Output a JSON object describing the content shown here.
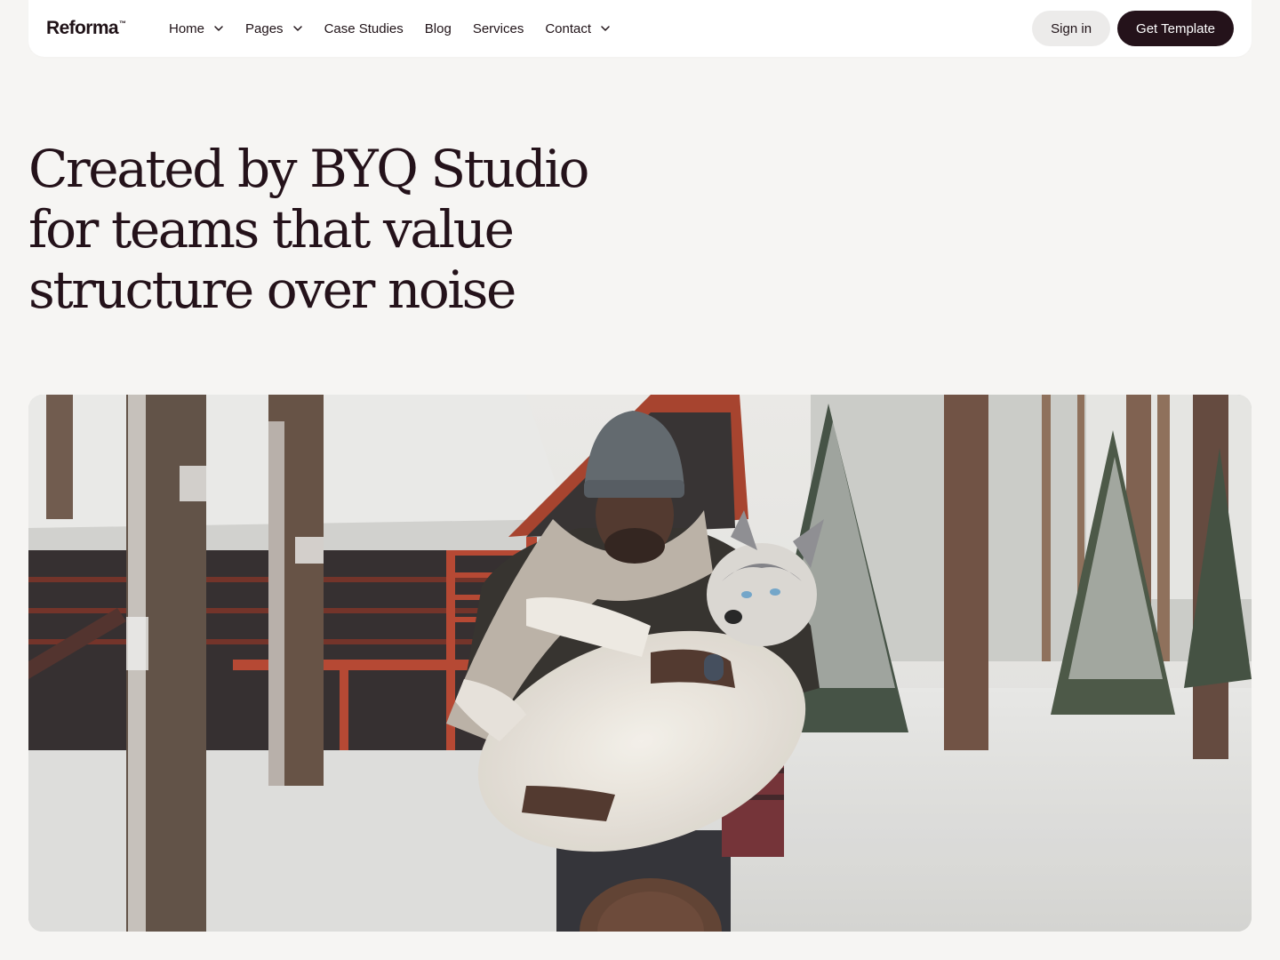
{
  "brand": {
    "name": "Reforma",
    "trademark": "™"
  },
  "nav": {
    "items": [
      {
        "label": "Home",
        "dropdown": true
      },
      {
        "label": "Pages",
        "dropdown": true
      },
      {
        "label": "Case Studies",
        "dropdown": false
      },
      {
        "label": "Blog",
        "dropdown": false
      },
      {
        "label": "Services",
        "dropdown": false
      },
      {
        "label": "Contact",
        "dropdown": true
      }
    ],
    "sign_in_label": "Sign in",
    "cta_label": "Get Template"
  },
  "hero": {
    "title_lines": [
      "Created by BYQ Studio",
      "for teams that value",
      "structure over noise"
    ],
    "image_subject": "man in a beanie carrying a husky dog in a snowy forest in front of a red-trimmed cabin"
  },
  "colors": {
    "background": "#f6f5f3",
    "text": "#1f1217",
    "cta": "#24121a",
    "sign_in_bg": "#ecebea"
  }
}
